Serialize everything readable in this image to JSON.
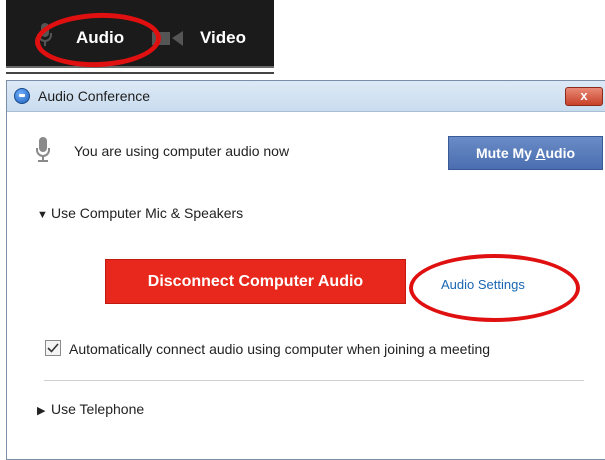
{
  "toolbar": {
    "audio_label": "Audio",
    "video_label": "Video",
    "icons": [
      "mic-icon",
      "camera-icon"
    ]
  },
  "dialog": {
    "title": "Audio Conference",
    "close_glyph": "x",
    "status_text": "You are using computer audio now",
    "mute_button": {
      "before": "Mute My ",
      "underlined": "A",
      "after": "udio"
    },
    "section_mic": "Use Computer Mic & Speakers",
    "disconnect_button": "Disconnect Computer Audio",
    "settings_link": "Audio Settings",
    "auto_connect": {
      "label": "Automatically connect audio using computer when joining a meeting",
      "checked": true
    },
    "section_phone": "Use Telephone"
  },
  "colors": {
    "annotation_red": "#e01010",
    "disconnect_red": "#e8281c",
    "mute_blue": "#4a6eb0",
    "link_blue": "#1a66b2"
  }
}
